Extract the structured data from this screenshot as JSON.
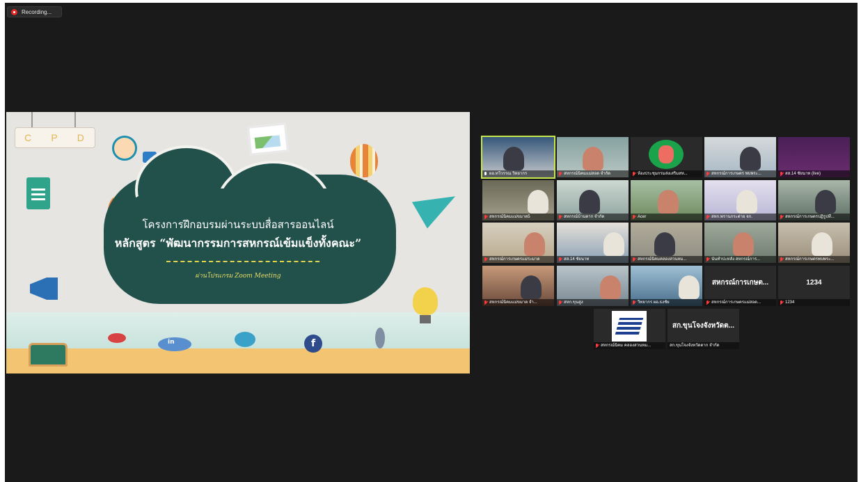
{
  "recording": {
    "label": "Recording..."
  },
  "slide": {
    "cpd_letters": [
      "C",
      "P",
      "D"
    ],
    "title": "โครงการฝึกอบรมผ่านระบบสื่อสารออนไลน์",
    "subtitle": "หลักสูตร “พัฒนากรรมการสหกรณ์เข้มแข็งทั้งคณะ”",
    "caption": "ผ่านโปรแกรม Zoom Meeting",
    "fb_glyph": "f",
    "in_glyph": "in"
  },
  "gallery": {
    "tiles": [
      {
        "name": "ผอ.ทวีวรรณ วิทยากร",
        "mic": "on",
        "active": true,
        "video": true
      },
      {
        "name": "สหกรณ์นิคมแม่สอด จำกัด",
        "mic": "off",
        "active": false,
        "video": true
      },
      {
        "name": "ห้องประชุมกรมส่งเสริมสห...",
        "mic": "off",
        "active": false,
        "video": true
      },
      {
        "name": "สหกรณ์การเกษตร พบพระ...",
        "mic": "off",
        "active": false,
        "video": true
      },
      {
        "name": "สส.14 ชัยนาท (live)",
        "mic": "off",
        "active": false,
        "video": true
      },
      {
        "name": "สหกรณ์นิคมแม่ขมาด5",
        "mic": "off",
        "active": false,
        "video": true
      },
      {
        "name": "สหกรณ์บ้านตาก จำกัด",
        "mic": "off",
        "active": false,
        "video": true
      },
      {
        "name": "Acer",
        "mic": "off",
        "active": false,
        "video": true
      },
      {
        "name": "สหก.พรานกระต่าย จก.",
        "mic": "off",
        "active": false,
        "video": true
      },
      {
        "name": "สหกรณ์การเกษตรปฏิรูปที่...",
        "mic": "off",
        "active": false,
        "video": true
      },
      {
        "name": "สหกรณ์การเกษตรแม่ระมาด",
        "mic": "off",
        "active": false,
        "video": true
      },
      {
        "name": "สส.14 ชัยนาท",
        "mic": "off",
        "active": false,
        "video": true
      },
      {
        "name": "สหกรณ์นิคมคลองสวนหม...",
        "mic": "off",
        "active": false,
        "video": true
      },
      {
        "name": "นันทำปะหลัง สหกรณ์การ...",
        "mic": "off",
        "active": false,
        "video": true
      },
      {
        "name": "สหกรณ์การเกษตรพบพระ...",
        "mic": "off",
        "active": false,
        "video": true
      },
      {
        "name": "สหกรณ์นิคมแม่ขมาด จำ...",
        "mic": "off",
        "active": false,
        "video": true
      },
      {
        "name": "สหก.ขุนสูง",
        "mic": "off",
        "active": false,
        "video": true
      },
      {
        "name": "วิทยากร ผอ.ธงชัย",
        "mic": "off",
        "active": false,
        "video": true
      },
      {
        "name": "สหกรณ์การเกษตรแม่สอด...",
        "mic": "off",
        "active": false,
        "video": false,
        "big": "สหกรณ์การเกษต..."
      },
      {
        "name": "1234",
        "mic": "off",
        "active": false,
        "video": false,
        "big": "1234"
      },
      {
        "name": "สหกรณ์นิคม คลองสวนหม...",
        "mic": "off",
        "active": false,
        "video": true
      },
      {
        "name": "สก.ขุนโจงจังหวัดตาก จำกัด",
        "mic": "none",
        "active": false,
        "video": false,
        "big": "สก.ขุนโจงจังหวัดต..."
      }
    ]
  }
}
